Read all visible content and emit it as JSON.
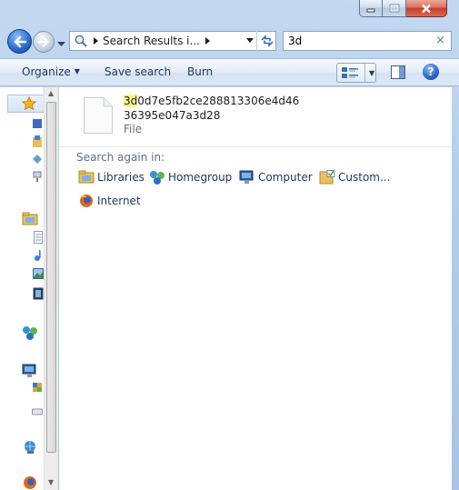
{
  "address": {
    "crumb": "Search Results i..."
  },
  "search": {
    "value": "3d",
    "clear_glyph": "×"
  },
  "commands": {
    "organize": "Organize",
    "save_search": "Save search",
    "burn": "Burn"
  },
  "help": {
    "label": "?"
  },
  "result": {
    "name_highlight": "3d",
    "name_rest": "0d7e5fb2ce288813306e4d4636395e047a3d28",
    "type": "File"
  },
  "search_again": {
    "label": "Search again in:",
    "locations": [
      "Libraries",
      "Homegroup",
      "Computer",
      "Custom...",
      "Internet"
    ]
  },
  "icons": [
    "back-arrow-icon",
    "forward-arrow-icon",
    "folder-icon",
    "refresh-icon",
    "views-icon",
    "preview-pane-icon",
    "help-icon",
    "file-icon",
    "favorites-star-icon",
    "libraries-icon",
    "homegroup-icon",
    "computer-icon",
    "custom-folder-icon",
    "internet-icon"
  ],
  "colors": {
    "accent": "#1e395b",
    "highlight": "#fff38a",
    "frame": "#b3cde9"
  }
}
